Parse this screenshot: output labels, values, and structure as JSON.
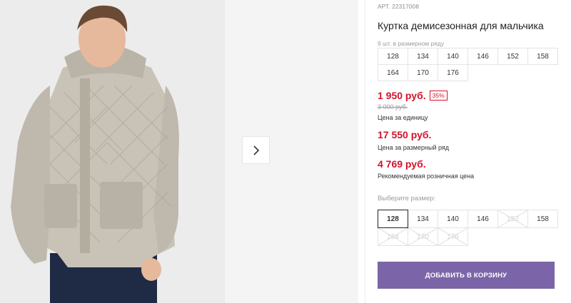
{
  "product": {
    "art": "АРТ. 22317008",
    "title": "Куртка демисезонная для мальчика",
    "in_row_label": "9 шт. в размерном ряду",
    "range_sizes": [
      "128",
      "134",
      "140",
      "146",
      "152",
      "158",
      "164",
      "170",
      "176"
    ],
    "price": "1 950 руб.",
    "discount": "35%",
    "old_price": "3 000 руб.",
    "price_unit_caption": "Цена за единицу",
    "price_range": "17 550 руб.",
    "price_range_caption": "Цена за размерный ряд",
    "price_retail": "4 769 руб.",
    "price_retail_caption": "Рекомендуемая розничная цена",
    "choose_size_label": "Выберите размер:",
    "select_sizes": [
      {
        "label": "128",
        "state": "selected"
      },
      {
        "label": "134",
        "state": "available"
      },
      {
        "label": "140",
        "state": "available"
      },
      {
        "label": "146",
        "state": "available"
      },
      {
        "label": "152",
        "state": "unavailable"
      },
      {
        "label": "158",
        "state": "available"
      },
      {
        "label": "164",
        "state": "unavailable"
      },
      {
        "label": "170",
        "state": "unavailable"
      },
      {
        "label": "176",
        "state": "unavailable"
      }
    ],
    "add_to_cart": "Добавить в корзину"
  },
  "gallery": {
    "next_icon": "chevron-right-icon"
  },
  "colors": {
    "price_red": "#d3132a",
    "button_purple": "#7b65a8"
  }
}
